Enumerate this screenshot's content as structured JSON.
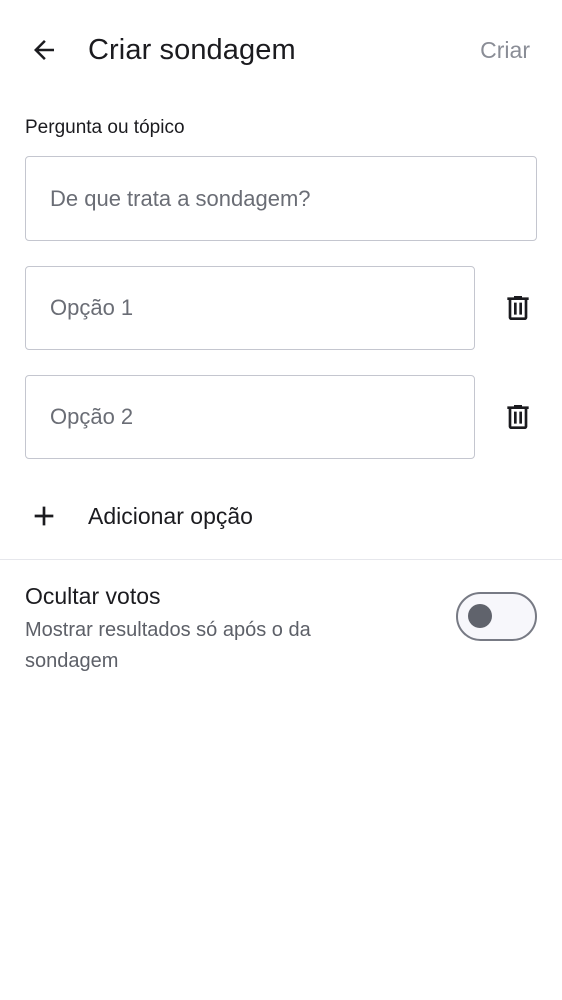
{
  "header": {
    "title": "Criar sondagem",
    "create_label": "Criar",
    "back_icon": "arrow-left-icon"
  },
  "question": {
    "label": "Pergunta ou tópico",
    "placeholder": "De que trata a sondagem?",
    "value": ""
  },
  "options": [
    {
      "placeholder": "Opção 1",
      "value": "",
      "delete_icon": "trash-icon"
    },
    {
      "placeholder": "Opção 2",
      "value": "",
      "delete_icon": "trash-icon"
    }
  ],
  "add_option": {
    "label": "Adicionar opção",
    "icon": "plus-icon"
  },
  "hide_votes": {
    "title": "Ocultar votos",
    "subtitle": "Mostrar resultados só após o da sondagem",
    "enabled": false
  },
  "colors": {
    "text": "#1b1b1f",
    "muted": "#8a8d96",
    "outline": "#c4c6cf",
    "toggle_border": "#777a84"
  }
}
